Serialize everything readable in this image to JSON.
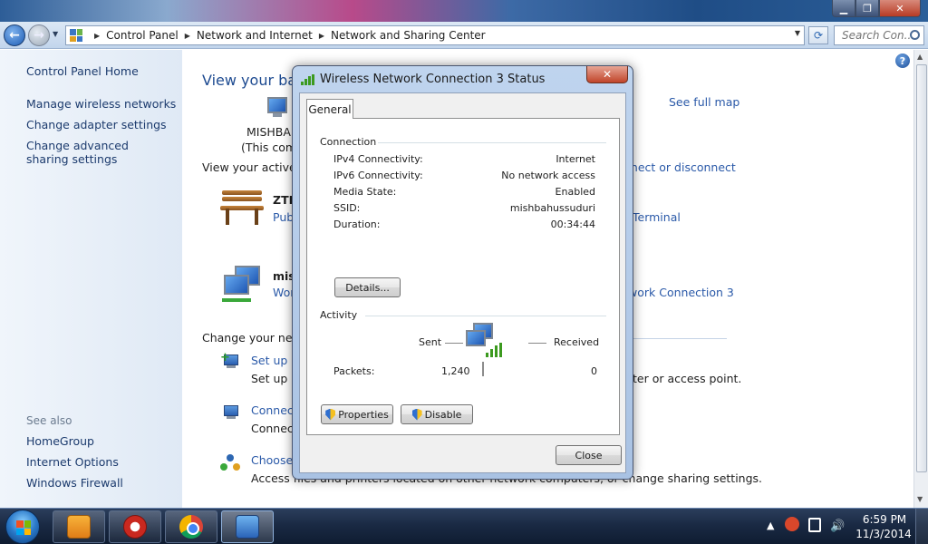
{
  "explorer": {
    "breadcrumbs": [
      "Control Panel",
      "Network and Internet",
      "Network and Sharing Center"
    ],
    "search_placeholder": "Search Con...",
    "left_pane": {
      "home": "Control Panel Home",
      "links": [
        "Manage wireless networks",
        "Change adapter settings",
        "Change advanced sharing settings"
      ],
      "see_also_label": "See also",
      "see_also": [
        "HomeGroup",
        "Internet Options",
        "Windows Firewall"
      ]
    },
    "main": {
      "heading": "View your bas",
      "see_full_map": "See full map",
      "pc_name": "MISHBAH",
      "pc_note": "(This comp",
      "active_networks_label": "View your active ne",
      "connect_disconnect": "nnect or disconnect",
      "network1": {
        "name": "ZTE",
        "type": "Pub",
        "access_right": "Terminal"
      },
      "network2": {
        "name": "mish",
        "type": "Wor",
        "connection_right": "work Connection 3"
      },
      "change_label": "Change your netw",
      "task1": {
        "link": "Set up a",
        "desc": "Set up a",
        "desc_right": "ter or access point."
      },
      "task2": {
        "link": "Connect",
        "desc": "Connect"
      },
      "task3": {
        "link": "Choose h",
        "desc": "Access files and printers located on other network computers, or change sharing settings."
      }
    }
  },
  "dialog": {
    "title": "Wireless Network Connection 3 Status",
    "tab": "General",
    "connection_label": "Connection",
    "rows": [
      {
        "label": "IPv4 Connectivity:",
        "value": "Internet"
      },
      {
        "label": "IPv6 Connectivity:",
        "value": "No network access"
      },
      {
        "label": "Media State:",
        "value": "Enabled"
      },
      {
        "label": "SSID:",
        "value": "mishbahussuduri"
      },
      {
        "label": "Duration:",
        "value": "00:34:44"
      }
    ],
    "details_button": "Details...",
    "activity_label": "Activity",
    "sent_label": "Sent",
    "received_label": "Received",
    "packets_label": "Packets:",
    "packets_sent": "1,240",
    "packets_received": "0",
    "properties_button": "Properties",
    "disable_button": "Disable",
    "close_button": "Close"
  },
  "taskbar": {
    "time": "6:59 PM",
    "date": "11/3/2014"
  },
  "colors": {
    "link": "#2a59a8",
    "heading": "#1e4b91",
    "taskbar": "#1a2a44",
    "close_red": "#c0442a"
  }
}
